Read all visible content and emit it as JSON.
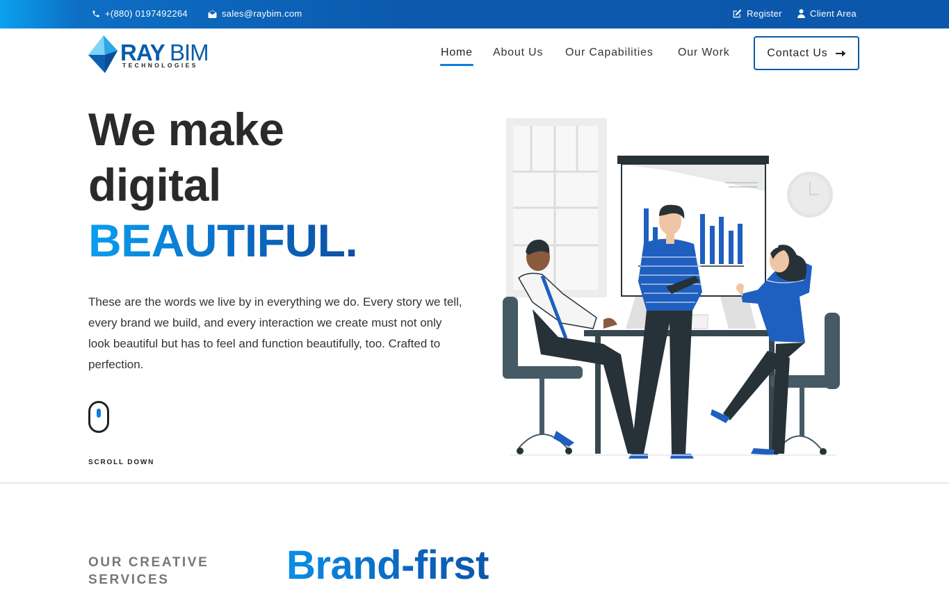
{
  "topbar": {
    "phone": "+(880) 0197492264",
    "email": "sales@raybim.com",
    "register": "Register",
    "client_area": "Client Area",
    "icons": [
      "phone-icon",
      "envelope-icon",
      "edit-icon",
      "user-icon"
    ]
  },
  "brand": {
    "name_ray": "RAY",
    "name_bim": "BIM",
    "tagline": "TECHNOLOGIES"
  },
  "nav": {
    "items": [
      {
        "label": "Home"
      },
      {
        "label": "About Us"
      },
      {
        "label": "Our Capabilities"
      },
      {
        "label": "Our Work"
      }
    ],
    "contact": "Contact Us",
    "active": "Home"
  },
  "hero": {
    "line1": "We make",
    "line2": "digital",
    "line3": "BEAUTIFUL.",
    "description": "These are the words we live by in everything we do. Every story we tell, every brand we build, and every interaction we create must not only look beautiful but has to feel and function beautifully, too. Crafted to perfection.",
    "scroll_label": "SCROLL DOWN"
  },
  "services": {
    "eyebrow": "OUR CREATIVE SERVICES",
    "heading": "Brand-first"
  },
  "colors": {
    "brand_blue": "#0b57ab",
    "accent_blue": "#0a9ef0",
    "text_dark": "#2a2a2a"
  }
}
